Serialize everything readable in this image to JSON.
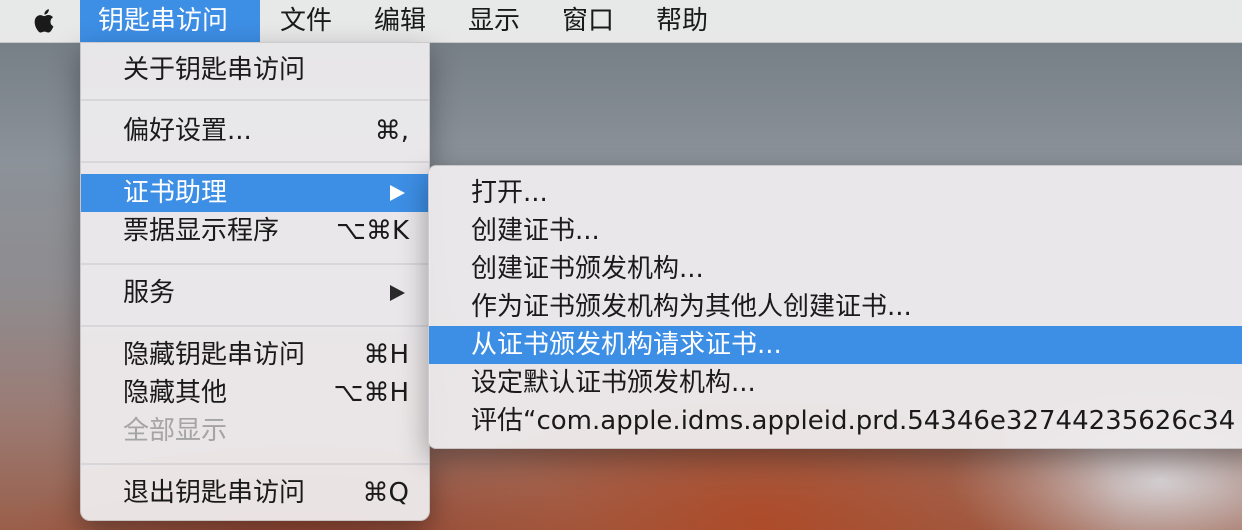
{
  "menubar": {
    "apple_icon": "apple-logo-icon",
    "items": [
      {
        "label": "钥匙串访问",
        "active": true
      },
      {
        "label": "文件"
      },
      {
        "label": "编辑"
      },
      {
        "label": "显示"
      },
      {
        "label": "窗口"
      },
      {
        "label": "帮助"
      }
    ]
  },
  "app_menu": {
    "items": [
      {
        "label": "关于钥匙串访问",
        "shortcut": ""
      },
      {
        "label": "偏好设置...",
        "shortcut": "⌘,"
      },
      {
        "label": "证书助理",
        "shortcut": "",
        "submenu": true,
        "highlighted": true
      },
      {
        "label": "票据显示程序",
        "shortcut": "⌥⌘K"
      },
      {
        "label": "服务",
        "shortcut": "",
        "submenu": true
      },
      {
        "label": "隐藏钥匙串访问",
        "shortcut": "⌘H"
      },
      {
        "label": "隐藏其他",
        "shortcut": "⌥⌘H"
      },
      {
        "label": "全部显示",
        "shortcut": "",
        "disabled": true
      },
      {
        "label": "退出钥匙串访问",
        "shortcut": "⌘Q"
      }
    ]
  },
  "certificate_assistant_menu": {
    "items": [
      {
        "label": "打开..."
      },
      {
        "label": "创建证书..."
      },
      {
        "label": "创建证书颁发机构..."
      },
      {
        "label": "作为证书颁发机构为其他人创建证书..."
      },
      {
        "label": "从证书颁发机构请求证书...",
        "highlighted": true
      },
      {
        "label": "设定默认证书颁发机构..."
      },
      {
        "label": "评估“com.apple.idms.appleid.prd.54346e32744235626c34"
      }
    ]
  },
  "colors": {
    "highlight": "#3d8ee5",
    "menu_background": "#f0eef0",
    "disabled_text": "#a4a4a4"
  }
}
